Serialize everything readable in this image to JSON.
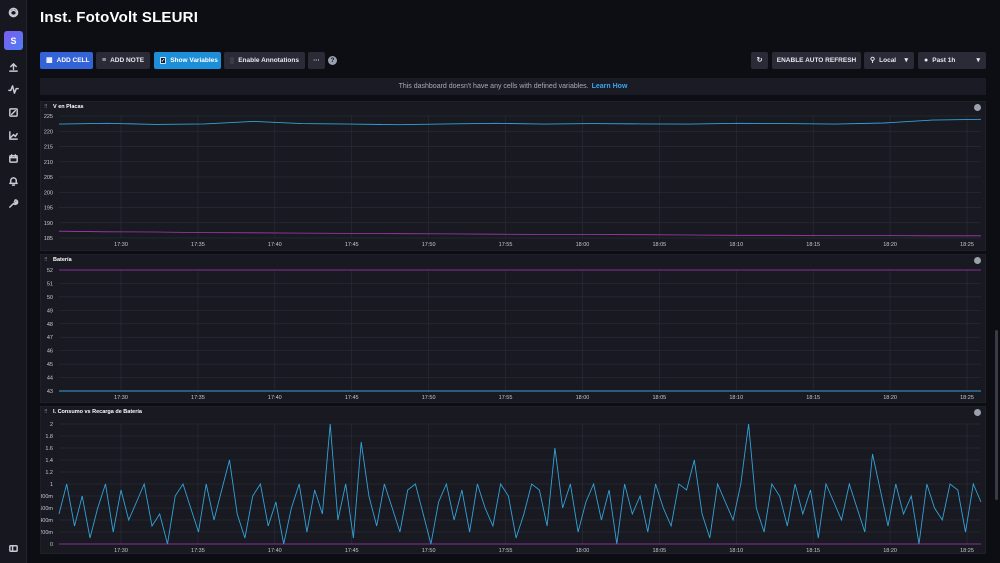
{
  "app": {
    "title": "Inst. FotoVolt SLEURI",
    "avatar_letter": "S"
  },
  "sidebar": {
    "icons": [
      "influx-logo-icon",
      "avatar",
      "upload-icon",
      "activity-icon",
      "edit-icon",
      "chart-icon",
      "calendar-icon",
      "bell-icon",
      "wrench-icon",
      "collapse-icon"
    ]
  },
  "toolbar": {
    "add_cell": "ADD CELL",
    "add_note": "ADD NOTE",
    "show_variables": "Show Variables",
    "enable_annotations": "Enable Annotations",
    "more": "···",
    "help": "?",
    "refresh_icon": "refresh-icon",
    "auto_refresh": "ENABLE AUTO REFRESH",
    "timezone": "Local",
    "time_range": "Past 1h"
  },
  "info": {
    "message": "This dashboard doesn't have any cells with defined variables.",
    "link": "Learn How"
  },
  "colors": {
    "accent_blue": "#3463d8",
    "accent_cyan": "#1d8ed8",
    "series_cyan": "#33a2d6",
    "series_magenta": "#a63ab7"
  },
  "x_ticks": [
    "17:30",
    "17:35",
    "17:40",
    "17:45",
    "17:50",
    "17:55",
    "18:00",
    "18:05",
    "18:10",
    "18:15",
    "18:20",
    "18:25"
  ],
  "chart_data": [
    {
      "type": "line",
      "title": "V en Placas",
      "x": [
        "17:30",
        "17:35",
        "17:40",
        "17:45",
        "17:50",
        "17:55",
        "18:00",
        "18:05",
        "18:10",
        "18:15",
        "18:20",
        "18:25"
      ],
      "y_ticks": [
        "225",
        "220",
        "215",
        "210",
        "205",
        "200",
        "195",
        "190",
        "185"
      ],
      "ylim": [
        182,
        227
      ],
      "series": [
        {
          "values": [
            224.0,
            224.3,
            223.9,
            224.1,
            225.0,
            224.2,
            224.0,
            223.8,
            224.1,
            224.3,
            224.0,
            224.2,
            224.1,
            224.0,
            224.3,
            224.2,
            224.0,
            224.4,
            225.5,
            225.8
          ]
        },
        {
          "values": [
            184.5,
            184.3,
            184.2,
            184.0,
            183.9,
            183.8,
            183.7,
            183.6,
            183.5,
            183.4,
            183.3,
            183.3,
            183.2,
            183.1,
            183.0,
            183.0,
            182.9,
            182.9,
            182.8,
            182.8
          ]
        }
      ]
    },
    {
      "type": "line",
      "title": "Batería",
      "x": [
        "17:30",
        "17:35",
        "17:40",
        "17:45",
        "17:50",
        "17:55",
        "18:00",
        "18:05",
        "18:10",
        "18:15",
        "18:20",
        "18:25"
      ],
      "y_ticks": [
        "52",
        "51",
        "50",
        "49",
        "48",
        "47",
        "46",
        "45",
        "44",
        "43"
      ],
      "ylim": [
        43,
        52
      ],
      "series": [
        {
          "values": [
            43.0,
            43.0,
            43.0,
            43.0,
            43.0,
            43.0,
            43.0,
            43.0,
            43.0,
            43.0,
            43.0,
            43.0,
            43.0,
            43.0,
            43.0,
            43.0,
            43.0,
            43.0,
            43.0,
            43.0
          ]
        },
        {
          "values": [
            52.0,
            52.0,
            52.0,
            52.0,
            52.0,
            52.0,
            52.0,
            52.0,
            52.0,
            52.0,
            52.0,
            52.0,
            52.0,
            52.0,
            52.0,
            52.0,
            52.0,
            52.0,
            52.0,
            52.0
          ]
        }
      ]
    },
    {
      "type": "line",
      "title": "I. Consumo vs Recarga de Batería",
      "x": [
        "17:30",
        "17:35",
        "17:40",
        "17:45",
        "17:50",
        "17:55",
        "18:00",
        "18:05",
        "18:10",
        "18:15",
        "18:20",
        "18:25"
      ],
      "y_ticks": [
        "2",
        "1.8",
        "1.6",
        "1.4",
        "1.2",
        "1",
        "800m",
        "600m",
        "400m",
        "200m",
        "0"
      ],
      "ylim": [
        0,
        2
      ],
      "series": [
        {
          "values": [
            0.5,
            1.0,
            0.3,
            0.8,
            0.1,
            0.6,
            1.0,
            0.2,
            0.9,
            0.4,
            0.7,
            1.0,
            0.3,
            0.5,
            0.0,
            0.8,
            1.0,
            0.6,
            0.2,
            1.0,
            0.4,
            0.9,
            1.4,
            0.5,
            0.1,
            0.8,
            1.0,
            0.3,
            0.7,
            0.0,
            0.6,
            1.0,
            0.2,
            0.9,
            0.5,
            2.0,
            0.4,
            1.0,
            0.1,
            1.7,
            0.8,
            0.3,
            1.0,
            0.6,
            0.2,
            0.9,
            1.0,
            0.5,
            0.0,
            0.7,
            1.0,
            0.4,
            0.9,
            0.2,
            1.0,
            0.6,
            0.3,
            1.0,
            0.8,
            0.1,
            0.5,
            1.0,
            0.9,
            0.3,
            1.6,
            0.6,
            1.0,
            0.2,
            0.7,
            1.0,
            0.4,
            0.9,
            0.0,
            1.0,
            0.5,
            0.8,
            0.2,
            1.0,
            0.6,
            0.3,
            1.0,
            0.9,
            1.4,
            0.5,
            0.1,
            1.0,
            0.7,
            0.4,
            1.0,
            2.0,
            0.6,
            0.2,
            1.0,
            0.8,
            0.3,
            1.0,
            0.5,
            0.9,
            0.1,
            1.0,
            0.7,
            0.4,
            1.0,
            0.6,
            0.2,
            1.5,
            0.9,
            0.3,
            1.0,
            0.5,
            0.8,
            0.0,
            1.0,
            0.6,
            0.4,
            1.0,
            0.9,
            0.2,
            1.0,
            0.7
          ]
        },
        {
          "values": [
            0.0,
            0.0,
            0.0,
            0.0,
            0.0,
            0.0,
            0.0,
            0.0,
            0.0,
            0.0,
            0.0,
            0.0,
            0.0,
            0.0,
            0.0,
            0.0,
            0.0,
            0.0,
            0.0,
            0.0
          ]
        }
      ]
    }
  ]
}
